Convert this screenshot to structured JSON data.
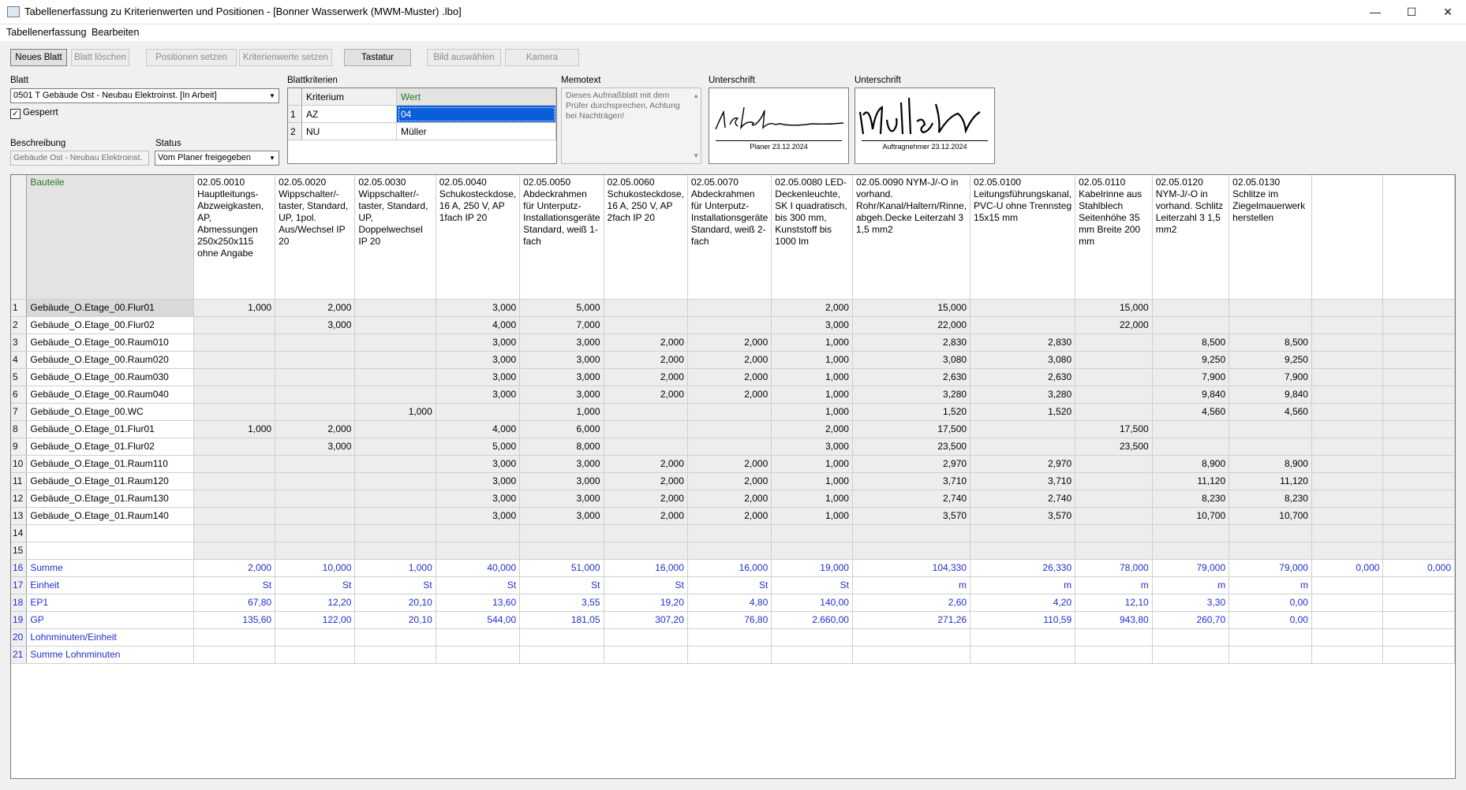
{
  "window": {
    "title": "Tabellenerfassung zu Kriterienwerten und Positionen - [Bonner Wasserwerk (MWM-Muster) .lbo]",
    "controls": {
      "minimize": "—",
      "maximize": "☐",
      "close": "✕"
    }
  },
  "menu": [
    "Tabellenerfassung",
    "Bearbeiten"
  ],
  "toolbar": [
    {
      "label": "Neues Blatt",
      "enabled": true
    },
    {
      "label": "Blatt löschen",
      "enabled": false
    },
    {
      "label": "Positionen setzen",
      "enabled": false
    },
    {
      "label": "Kriterienwerte setzen",
      "enabled": false
    },
    {
      "label": "Tastatur",
      "enabled": true
    },
    {
      "label": "Bild auswählen",
      "enabled": false
    },
    {
      "label": "Kamera",
      "enabled": false
    }
  ],
  "sheet": {
    "label": "Blatt",
    "value": "0501 T  Gebäude Ost - Neubau Elektroinst.  [In Arbeit]",
    "locked_label": "Gesperrt",
    "locked_checked": true,
    "description_label": "Beschreibung",
    "description_value": "Gebäude Ost - Neubau Elektroinst.",
    "status_label": "Status",
    "status_value": "Vom Planer freigegeben"
  },
  "criteria": {
    "label": "Blattkriterien",
    "headers": [
      "Kriterium",
      "Wert"
    ],
    "rows": [
      {
        "num": "1",
        "key": "AZ",
        "value": "04"
      },
      {
        "num": "2",
        "key": "NU",
        "value": "Müller"
      }
    ]
  },
  "memo": {
    "label": "Memotext",
    "text": "Dieses Aufmaßblatt mit dem Prüfer durchsprechen, Achtung bei Nachträgen!"
  },
  "signatures": [
    {
      "label": "Unterschrift",
      "caption": "Planer    23.12.2024"
    },
    {
      "label": "Unterschrift",
      "caption": "Auftragnehmer    23.12.2024"
    }
  ],
  "grid": {
    "first_header": "Bauteile",
    "columns": [
      "02.05.0010 Hauptleitungs-Abzweigkasten, AP, Abmessungen 250x250x115 ohne Angabe",
      "02.05.0020 Wippschalter/-taster, Standard, UP, 1pol. Aus/Wechsel IP 20",
      "02.05.0030 Wippschalter/-taster, Standard, UP, Doppelwechsel IP 20",
      "02.05.0040 Schukosteckdose, 16 A, 250 V, AP 1fach IP 20",
      "02.05.0050 Abdeckrahmen für Unterputz-Installationsgeräte Standard, weiß 1-fach",
      "02.05.0060 Schukosteckdose, 16 A, 250 V, AP 2fach IP 20",
      "02.05.0070 Abdeckrahmen für Unterputz-Installationsgeräte Standard, weiß 2-fach",
      "02.05.0080 LED-Deckenleuchte, SK I quadratisch, bis 300 mm, Kunststoff bis 1000 lm",
      "02.05.0090 NYM-J/-O in vorhand. Rohr/Kanal/Haltern/Rinne, abgeh.Decke Leiterzahl 3 1,5 mm2",
      "02.05.0100 Leitungsführungskanal, PVC-U ohne Trennsteg 15x15 mm",
      "02.05.0110 Kabelrinne aus Stahlblech Seitenhöhe 35 mm Breite 200 mm",
      "02.05.0120 NYM-J/-O in vorhand. Schlitz Leiterzahl 3 1,5 mm2",
      "02.05.0130 Schlitze im Ziegelmauerwerk herstellen",
      "",
      ""
    ],
    "rows": [
      {
        "num": "1",
        "name": "Gebäude_O.Etage_00.Flur01",
        "values": [
          "1,000",
          "2,000",
          "",
          "3,000",
          "5,000",
          "",
          "",
          "2,000",
          "15,000",
          "",
          "15,000",
          "",
          "",
          "",
          ""
        ]
      },
      {
        "num": "2",
        "name": "Gebäude_O.Etage_00.Flur02",
        "values": [
          "",
          "3,000",
          "",
          "4,000",
          "7,000",
          "",
          "",
          "3,000",
          "22,000",
          "",
          "22,000",
          "",
          "",
          "",
          ""
        ]
      },
      {
        "num": "3",
        "name": "Gebäude_O.Etage_00.Raum010",
        "values": [
          "",
          "",
          "",
          "3,000",
          "3,000",
          "2,000",
          "2,000",
          "1,000",
          "2,830",
          "2,830",
          "",
          "8,500",
          "8,500",
          "",
          ""
        ]
      },
      {
        "num": "4",
        "name": "Gebäude_O.Etage_00.Raum020",
        "values": [
          "",
          "",
          "",
          "3,000",
          "3,000",
          "2,000",
          "2,000",
          "1,000",
          "3,080",
          "3,080",
          "",
          "9,250",
          "9,250",
          "",
          ""
        ]
      },
      {
        "num": "5",
        "name": "Gebäude_O.Etage_00.Raum030",
        "values": [
          "",
          "",
          "",
          "3,000",
          "3,000",
          "2,000",
          "2,000",
          "1,000",
          "2,630",
          "2,630",
          "",
          "7,900",
          "7,900",
          "",
          ""
        ]
      },
      {
        "num": "6",
        "name": "Gebäude_O.Etage_00.Raum040",
        "values": [
          "",
          "",
          "",
          "3,000",
          "3,000",
          "2,000",
          "2,000",
          "1,000",
          "3,280",
          "3,280",
          "",
          "9,840",
          "9,840",
          "",
          ""
        ]
      },
      {
        "num": "7",
        "name": "Gebäude_O.Etage_00.WC",
        "values": [
          "",
          "",
          "1,000",
          "",
          "1,000",
          "",
          "",
          "1,000",
          "1,520",
          "1,520",
          "",
          "4,560",
          "4,560",
          "",
          ""
        ]
      },
      {
        "num": "8",
        "name": "Gebäude_O.Etage_01.Flur01",
        "values": [
          "1,000",
          "2,000",
          "",
          "4,000",
          "6,000",
          "",
          "",
          "2,000",
          "17,500",
          "",
          "17,500",
          "",
          "",
          "",
          ""
        ]
      },
      {
        "num": "9",
        "name": "Gebäude_O.Etage_01.Flur02",
        "values": [
          "",
          "3,000",
          "",
          "5,000",
          "8,000",
          "",
          "",
          "3,000",
          "23,500",
          "",
          "23,500",
          "",
          "",
          "",
          ""
        ]
      },
      {
        "num": "10",
        "name": "Gebäude_O.Etage_01.Raum110",
        "values": [
          "",
          "",
          "",
          "3,000",
          "3,000",
          "2,000",
          "2,000",
          "1,000",
          "2,970",
          "2,970",
          "",
          "8,900",
          "8,900",
          "",
          ""
        ]
      },
      {
        "num": "11",
        "name": "Gebäude_O.Etage_01.Raum120",
        "values": [
          "",
          "",
          "",
          "3,000",
          "3,000",
          "2,000",
          "2,000",
          "1,000",
          "3,710",
          "3,710",
          "",
          "11,120",
          "11,120",
          "",
          ""
        ]
      },
      {
        "num": "12",
        "name": "Gebäude_O.Etage_01.Raum130",
        "values": [
          "",
          "",
          "",
          "3,000",
          "3,000",
          "2,000",
          "2,000",
          "1,000",
          "2,740",
          "2,740",
          "",
          "8,230",
          "8,230",
          "",
          ""
        ]
      },
      {
        "num": "13",
        "name": "Gebäude_O.Etage_01.Raum140",
        "values": [
          "",
          "",
          "",
          "3,000",
          "3,000",
          "2,000",
          "2,000",
          "1,000",
          "3,570",
          "3,570",
          "",
          "10,700",
          "10,700",
          "",
          ""
        ]
      },
      {
        "num": "14",
        "name": "",
        "values": [
          "",
          "",
          "",
          "",
          "",
          "",
          "",
          "",
          "",
          "",
          "",
          "",
          "",
          "",
          ""
        ]
      },
      {
        "num": "15",
        "name": "",
        "values": [
          "",
          "",
          "",
          "",
          "",
          "",
          "",
          "",
          "",
          "",
          "",
          "",
          "",
          "",
          ""
        ]
      }
    ],
    "summary_rows": [
      {
        "num": "16",
        "name": "Summe",
        "values": [
          "2,000",
          "10,000",
          "1,000",
          "40,000",
          "51,000",
          "16,000",
          "16,000",
          "19,000",
          "104,330",
          "26,330",
          "78,000",
          "79,000",
          "79,000",
          "0,000",
          "0,000"
        ]
      },
      {
        "num": "17",
        "name": "Einheit",
        "values": [
          "St",
          "St",
          "St",
          "St",
          "St",
          "St",
          "St",
          "St",
          "m",
          "m",
          "m",
          "m",
          "m",
          "",
          ""
        ]
      },
      {
        "num": "18",
        "name": "EP1",
        "values": [
          "67,80",
          "12,20",
          "20,10",
          "13,60",
          "3,55",
          "19,20",
          "4,80",
          "140,00",
          "2,60",
          "4,20",
          "12,10",
          "3,30",
          "0,00",
          "",
          ""
        ]
      },
      {
        "num": "19",
        "name": "GP",
        "values": [
          "135,60",
          "122,00",
          "20,10",
          "544,00",
          "181,05",
          "307,20",
          "76,80",
          "2.660,00",
          "271,26",
          "110,59",
          "943,80",
          "260,70",
          "0,00",
          "",
          ""
        ]
      },
      {
        "num": "20",
        "name": "Lohnminuten/Einheit",
        "values": [
          "",
          "",
          "",
          "",
          "",
          "",
          "",
          "",
          "",
          "",
          "",
          "",
          "",
          "",
          ""
        ]
      },
      {
        "num": "21",
        "name": "Summe Lohnminuten",
        "values": [
          "",
          "",
          "",
          "",
          "",
          "",
          "",
          "",
          "",
          "",
          "",
          "",
          "",
          "",
          ""
        ]
      }
    ]
  }
}
